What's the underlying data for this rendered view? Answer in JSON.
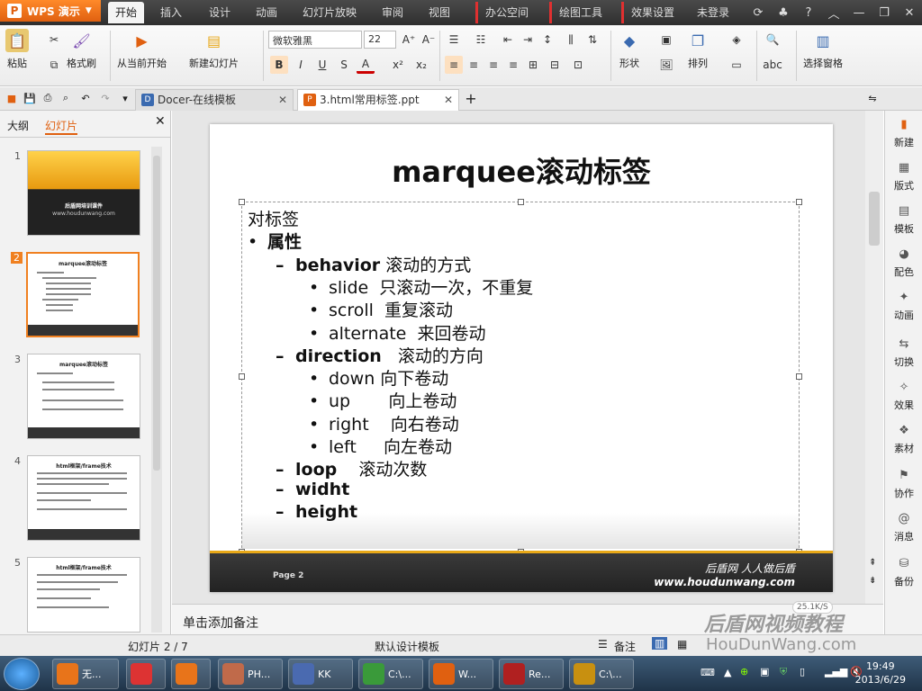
{
  "app": {
    "name": "WPS 演示",
    "colors": {
      "accent": "#e06010",
      "title_bar": "#2f2f2f",
      "slide_gold": "#e8a818"
    }
  },
  "menu": {
    "tabs": [
      "开始",
      "插入",
      "设计",
      "动画",
      "幻灯片放映",
      "审阅",
      "视图"
    ],
    "ctx_tabs": [
      "办公空间",
      "绘图工具",
      "效果设置"
    ],
    "login": "未登录"
  },
  "ribbon": {
    "paste": "粘贴",
    "format_painter": "格式刷",
    "from_current": "从当前开始",
    "new_slide": "新建幻灯片",
    "font_name": "微软雅黑",
    "font_size": "22",
    "shape": "形状",
    "arrange": "排列",
    "selection_pane": "选择窗格",
    "bold": "B",
    "italic": "I",
    "underline": "U",
    "strike": "S",
    "font_color": "A"
  },
  "doc_tabs": [
    {
      "label": "Docer-在线模板",
      "icon": "docer-icon"
    },
    {
      "label": "3.html常用标签.ppt",
      "icon": "ppt-icon"
    }
  ],
  "left_panel": {
    "tabs": [
      "大纲",
      "幻灯片"
    ],
    "thumbnails": [
      {
        "num": "1",
        "title": "后盾网培训课件",
        "sub": "www.houdunwang.com"
      },
      {
        "num": "2",
        "title": "marquee滚动标签"
      },
      {
        "num": "3",
        "title": "marquee滚动标签"
      },
      {
        "num": "4",
        "title": "html框架/frame技术"
      },
      {
        "num": "5",
        "title": "html框架/frame技术"
      }
    ]
  },
  "slide": {
    "title": "marquee滚动标签",
    "lines": [
      {
        "indent": 0,
        "bullet": "",
        "bold": "",
        "text": "对标签"
      },
      {
        "indent": 0,
        "bullet": "•",
        "bold": "属性",
        "text": ""
      },
      {
        "indent": 1,
        "bullet": "–",
        "bold": "behavior",
        "text": " 滚动的方式"
      },
      {
        "indent": 2,
        "bullet": "•",
        "bold": "",
        "text": "slide  只滚动一次，不重复"
      },
      {
        "indent": 2,
        "bullet": "•",
        "bold": "",
        "text": "scroll  重复滚动"
      },
      {
        "indent": 2,
        "bullet": "•",
        "bold": "",
        "text": "alternate  来回卷动"
      },
      {
        "indent": 1,
        "bullet": "–",
        "bold": "direction",
        "text": "   滚动的方向"
      },
      {
        "indent": 2,
        "bullet": "•",
        "bold": "",
        "text": "down 向下卷动"
      },
      {
        "indent": 2,
        "bullet": "•",
        "bold": "",
        "text": "up       向上卷动"
      },
      {
        "indent": 2,
        "bullet": "•",
        "bold": "",
        "text": "right    向右卷动"
      },
      {
        "indent": 2,
        "bullet": "•",
        "bold": "",
        "text": "left     向左卷动"
      },
      {
        "indent": 1,
        "bullet": "–",
        "bold": "loop",
        "text": "    滚动次数"
      },
      {
        "indent": 1,
        "bullet": "–",
        "bold": "widht",
        "text": ""
      },
      {
        "indent": 1,
        "bullet": "–",
        "bold": "height",
        "text": ""
      }
    ],
    "footer_page": "Page  2",
    "brand": "后盾网 人人做后盾",
    "url": "www.houdunwang.com"
  },
  "notes_placeholder": "单击添加备注",
  "right_bar": [
    "新建",
    "版式",
    "模板",
    "配色",
    "动画",
    "切换",
    "效果",
    "素材",
    "协作",
    "消息",
    "备份"
  ],
  "status": {
    "slide_pos": "幻灯片 2 / 7",
    "template": "默认设计模板",
    "notes": "备注"
  },
  "taskbar": {
    "items": [
      {
        "label": "无...",
        "icon": "firefox-icon",
        "color": "#e8741a"
      },
      {
        "label": "",
        "icon": "chrome-icon",
        "color": "#d33"
      },
      {
        "label": "",
        "icon": "app-icon",
        "color": "#e8741a"
      },
      {
        "label": "PH...",
        "icon": "users-icon",
        "color": "#c06a4a"
      },
      {
        "label": "KK",
        "icon": "kk-icon",
        "color": "#4a6ab0"
      },
      {
        "label": "C:\\...",
        "icon": "clover-icon",
        "color": "#3a9a3a"
      },
      {
        "label": "W...",
        "icon": "wps-icon",
        "color": "#e06010"
      },
      {
        "label": "Re...",
        "icon": "record-icon",
        "color": "#b02020"
      },
      {
        "label": "C:\\...",
        "icon": "cmd-icon",
        "color": "#c89010"
      }
    ],
    "time": "19:49",
    "date": "2013/6/29"
  },
  "watermark": {
    "cn": "后盾网视频教程",
    "en": "HouDunWang.com",
    "speed": "25.1K/S"
  }
}
